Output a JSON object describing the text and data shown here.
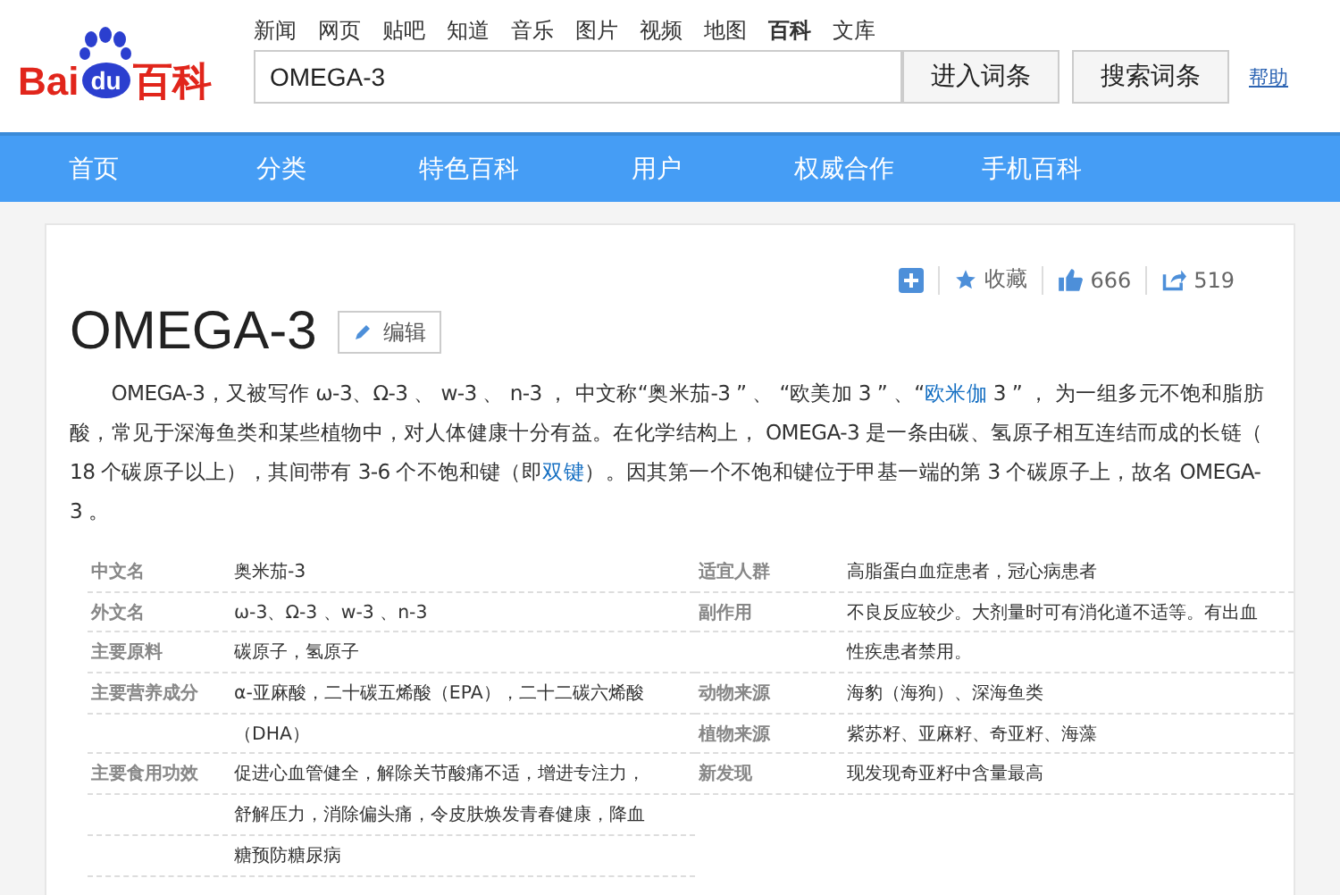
{
  "top_links": [
    {
      "label": "新闻",
      "selected": false
    },
    {
      "label": "网页",
      "selected": false
    },
    {
      "label": "贴吧",
      "selected": false
    },
    {
      "label": "知道",
      "selected": false
    },
    {
      "label": "音乐",
      "selected": false
    },
    {
      "label": "图片",
      "selected": false
    },
    {
      "label": "视频",
      "selected": false
    },
    {
      "label": "地图",
      "selected": false
    },
    {
      "label": "百科",
      "selected": true
    },
    {
      "label": "文库",
      "selected": false
    }
  ],
  "logo": {
    "brand_left": "Bai",
    "brand_mark": "du",
    "brand_right": "百科"
  },
  "search": {
    "value": "OMEGA-3",
    "buttons": [
      "进入词条",
      "搜索词条"
    ],
    "help": "帮助"
  },
  "nav": [
    "首页",
    "分类",
    "特色百科",
    "用户",
    "权威合作",
    "手机百科"
  ],
  "actions": {
    "collect": "收藏",
    "likes": "666",
    "shares": "519"
  },
  "title": "OMEGA-3",
  "edit": "编辑",
  "paragraph": [
    {
      "kind": "text",
      "text": "OMEGA-3，又被写作 ω-3、Ω-3 、 w-3 、 n-3 ， 中文称“奥米茄-3 ” 、 “欧美加 3 ” 、“"
    },
    {
      "kind": "link",
      "text": "欧米伽"
    },
    {
      "kind": "text",
      "text": " 3 ” ， 为一组多元不饱和脂肪酸，常见于深海鱼类和某些植物中，对人体健康十分有益。在化学结构上， OMEGA-3 是一条由碳、氢原子相互连结而成的长链（ 18 个碳原子以上），其间带有 3-6 个不饱和键（即"
    },
    {
      "kind": "link",
      "text": "双键"
    },
    {
      "kind": "text",
      "text": "）。因其第一个不饱和键位于甲基一端的第 3 个碳原子上，故名 OMEGA-3 。"
    }
  ],
  "info_left": [
    {
      "name": "中文名",
      "lines": [
        "奥米茄-3"
      ]
    },
    {
      "name": "外文名",
      "lines": [
        "ω-3、Ω-3 、w-3 、n-3"
      ]
    },
    {
      "name": "主要原料",
      "lines": [
        "碳原子，氢原子"
      ]
    },
    {
      "name": "主要营养成分",
      "lines": [
        "α-亚麻酸，二十碳五烯酸（EPA），二十二碳六烯酸",
        "（DHA）"
      ]
    },
    {
      "name": "主要食用功效",
      "lines": [
        "促进心血管健全，解除关节酸痛不适，增进专注力，",
        "舒解压力，消除偏头痛，令皮肤焕发青春健康，降血",
        "糖预防糖尿病"
      ]
    }
  ],
  "info_right": [
    {
      "name": "适宜人群",
      "lines": [
        "高脂蛋白血症患者，冠心病患者"
      ]
    },
    {
      "name": "副作用",
      "lines": [
        "不良反应较少。大剂量时可有消化道不适等。有出血",
        "性疾患者禁用。"
      ]
    },
    {
      "name": "动物来源",
      "lines": [
        "海豹（海狗）、深海鱼类"
      ]
    },
    {
      "name": "植物来源",
      "lines": [
        "紫苏籽、亚麻籽、奇亚籽、海藻"
      ]
    },
    {
      "name": "新发现",
      "lines": [
        "现发现奇亚籽中含量最高"
      ]
    }
  ]
}
